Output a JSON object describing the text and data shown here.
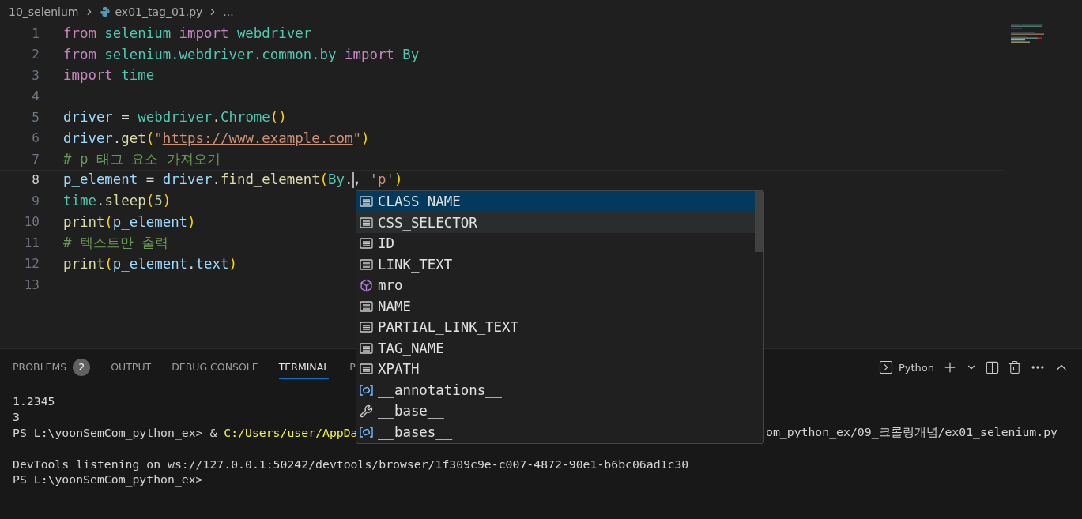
{
  "breadcrumbs": [
    {
      "label": "10_selenium",
      "kind": "folder"
    },
    {
      "label": "ex01_tag_01.py",
      "kind": "python"
    },
    {
      "label": "...",
      "kind": "more"
    }
  ],
  "code_lines": [
    {
      "number": "1",
      "current": false,
      "tokens": [
        {
          "text": "from",
          "kind": "keyword"
        },
        {
          "text": " selenium ",
          "kind": "module"
        },
        {
          "text": "import",
          "kind": "keyword"
        },
        {
          "text": " webdriver",
          "kind": "module"
        }
      ]
    },
    {
      "number": "2",
      "current": false,
      "tokens": [
        {
          "text": "from",
          "kind": "keyword"
        },
        {
          "text": " selenium.webdriver.common.by ",
          "kind": "module"
        },
        {
          "text": "import",
          "kind": "keyword"
        },
        {
          "text": " By",
          "kind": "module"
        }
      ]
    },
    {
      "number": "3",
      "current": false,
      "tokens": [
        {
          "text": "import",
          "kind": "keyword"
        },
        {
          "text": " time",
          "kind": "module"
        }
      ]
    },
    {
      "number": "4",
      "current": false
    },
    {
      "number": "5",
      "current": false,
      "tokens": [
        {
          "text": "driver",
          "kind": "variable"
        },
        {
          "text": " = ",
          "kind": "plain"
        },
        {
          "text": "webdriver",
          "kind": "module"
        },
        {
          "text": ".",
          "kind": "plain"
        },
        {
          "text": "Chrome",
          "kind": "module"
        },
        {
          "text": "()",
          "kind": "bracket"
        }
      ]
    },
    {
      "number": "6",
      "current": false,
      "tokens": [
        {
          "text": "driver",
          "kind": "variable"
        },
        {
          "text": ".",
          "kind": "plain"
        },
        {
          "text": "get",
          "kind": "function"
        },
        {
          "text": "(",
          "kind": "bracket"
        },
        {
          "text": "\"",
          "kind": "string"
        },
        {
          "text": "https://www.example.com",
          "kind": "link"
        },
        {
          "text": "\"",
          "kind": "string"
        },
        {
          "text": ")",
          "kind": "bracket"
        }
      ]
    },
    {
      "number": "7",
      "current": false,
      "tokens": [
        {
          "text": "# p 태그 요소 가져오기",
          "kind": "comment"
        }
      ]
    },
    {
      "number": "8",
      "current": true,
      "tokens": [
        {
          "text": "p_element",
          "kind": "variable"
        },
        {
          "text": " = ",
          "kind": "plain"
        },
        {
          "text": "driver",
          "kind": "variable"
        },
        {
          "text": ".",
          "kind": "plain"
        },
        {
          "text": "find_element",
          "kind": "function"
        },
        {
          "text": "(",
          "kind": "bracket"
        },
        {
          "text": "By",
          "kind": "module"
        },
        {
          "text": ".",
          "kind": "plain",
          "cursor": true
        },
        {
          "text": ", ",
          "kind": "plain"
        },
        {
          "text": "'p'",
          "kind": "string"
        },
        {
          "text": ")",
          "kind": "bracket"
        }
      ]
    },
    {
      "number": "9",
      "current": false,
      "tokens": [
        {
          "text": "time",
          "kind": "module"
        },
        {
          "text": ".",
          "kind": "plain"
        },
        {
          "text": "sleep",
          "kind": "function"
        },
        {
          "text": "(",
          "kind": "bracket"
        },
        {
          "text": "5",
          "kind": "number"
        },
        {
          "text": ")",
          "kind": "bracket"
        }
      ]
    },
    {
      "number": "10",
      "current": false,
      "tokens": [
        {
          "text": "print",
          "kind": "function"
        },
        {
          "text": "(",
          "kind": "bracket"
        },
        {
          "text": "p_element",
          "kind": "variable"
        },
        {
          "text": ")",
          "kind": "bracket"
        }
      ]
    },
    {
      "number": "11",
      "current": false,
      "tokens": [
        {
          "text": "# 텍스트만 출력",
          "kind": "comment"
        }
      ]
    },
    {
      "number": "12",
      "current": false,
      "tokens": [
        {
          "text": "print",
          "kind": "function"
        },
        {
          "text": "(",
          "kind": "bracket"
        },
        {
          "text": "p_element",
          "kind": "variable"
        },
        {
          "text": ".",
          "kind": "plain"
        },
        {
          "text": "text",
          "kind": "variable"
        },
        {
          "text": ")",
          "kind": "bracket"
        }
      ]
    },
    {
      "number": "13",
      "current": false
    }
  ],
  "suggestions": [
    {
      "label": "CLASS_NAME",
      "kind": "field",
      "selected": true,
      "hovered": false
    },
    {
      "label": "CSS_SELECTOR",
      "kind": "field",
      "selected": false,
      "hovered": true
    },
    {
      "label": "ID",
      "kind": "field",
      "selected": false,
      "hovered": false
    },
    {
      "label": "LINK_TEXT",
      "kind": "field",
      "selected": false,
      "hovered": false
    },
    {
      "label": "mro",
      "kind": "class",
      "selected": false,
      "hovered": false
    },
    {
      "label": "NAME",
      "kind": "field",
      "selected": false,
      "hovered": false
    },
    {
      "label": "PARTIAL_LINK_TEXT",
      "kind": "field",
      "selected": false,
      "hovered": false
    },
    {
      "label": "TAG_NAME",
      "kind": "field",
      "selected": false,
      "hovered": false
    },
    {
      "label": "XPATH",
      "kind": "field",
      "selected": false,
      "hovered": false
    },
    {
      "label": "__annotations__",
      "kind": "variable",
      "selected": false,
      "hovered": false
    },
    {
      "label": "__base__",
      "kind": "property",
      "selected": false,
      "hovered": false
    },
    {
      "label": "__bases__",
      "kind": "variable",
      "selected": false,
      "hovered": false
    }
  ],
  "panel": {
    "tabs": [
      {
        "label": "PROBLEMS",
        "badge": "2",
        "selected": false
      },
      {
        "label": "OUTPUT",
        "selected": false
      },
      {
        "label": "DEBUG CONSOLE",
        "selected": false
      },
      {
        "label": "TERMINAL",
        "selected": true
      },
      {
        "label": "P",
        "selected": false
      }
    ],
    "terminal_profile": "Python",
    "terminal_lines": [
      {
        "kind": "output",
        "left": [
          {
            "text": "1.2345",
            "kind": "plain"
          }
        ]
      },
      {
        "kind": "output",
        "left": [
          {
            "text": "3",
            "kind": "plain"
          }
        ]
      },
      {
        "kind": "output",
        "left": [
          {
            "text": "PS L:\\yoonSemCom_python_ex> & ",
            "kind": "plain"
          },
          {
            "text": "C:/Users/user/AppDa",
            "kind": "path"
          }
        ],
        "right": [
          {
            "text": "om_python_ex/09_크롤링개념/ex01_selenium.py",
            "kind": "plain"
          }
        ]
      },
      {
        "kind": "blank"
      },
      {
        "kind": "output",
        "left": [
          {
            "text": "DevTools listening on ws://127.0.0.1:50242/devtools/browser/1f309c9e-c007-4872-90e1-b6bc06ad1c30",
            "kind": "plain"
          }
        ]
      },
      {
        "kind": "output",
        "left": [
          {
            "text": "PS L:\\yoonSemCom_python_ex>",
            "kind": "plain"
          }
        ]
      }
    ]
  }
}
